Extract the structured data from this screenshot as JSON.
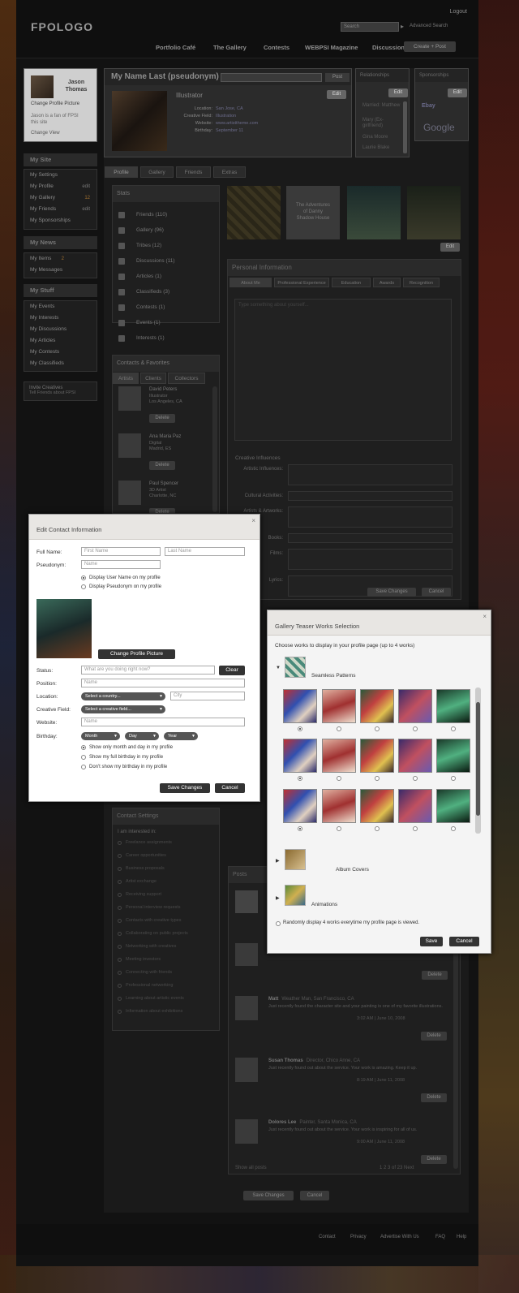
{
  "header": {
    "logo": "FPOLOGO",
    "logout": "Logout",
    "search_placeholder": "Search",
    "advanced_search": "Advanced Search",
    "nav": [
      "Portfolio Café",
      "The Gallery",
      "Contests",
      "WEBPSI Magazine",
      "Discussions"
    ],
    "create": "Create + Post"
  },
  "user": {
    "name_line1": "Jason",
    "name_line2": "Thomas",
    "change_pic": "Change Profile Picture",
    "status_line1": "Jason is a fan of FPSI",
    "status_line2": "this site",
    "change_view": "Change View"
  },
  "sidebar": {
    "my_site_head": "My Site",
    "my_site_items": [
      {
        "label": "My Settings",
        "cnt": ""
      },
      {
        "label": "My Profile",
        "cnt": "edit"
      },
      {
        "label": "My Gallery",
        "cnt": "12"
      },
      {
        "label": "My Friends",
        "cnt": "edit"
      },
      {
        "label": "My Sponsorships",
        "cnt": ""
      }
    ],
    "my_news_head": "My News",
    "my_news_items": [
      {
        "label": "My Items",
        "cnt": "2"
      },
      {
        "label": "My Messages",
        "cnt": ""
      }
    ],
    "my_stuff_head": "My Stuff",
    "my_stuff_items": [
      {
        "label": "My Events",
        "cnt": ""
      },
      {
        "label": "My Interests",
        "cnt": ""
      },
      {
        "label": "My Discussions",
        "cnt": ""
      },
      {
        "label": "My Articles",
        "cnt": ""
      },
      {
        "label": "My Contests",
        "cnt": ""
      },
      {
        "label": "My Classifieds",
        "cnt": ""
      }
    ],
    "invite_line1": "Invite Creatives",
    "invite_line2": "Tell Friends about FPSI"
  },
  "profile": {
    "header": "My Name Last (pseudonym)",
    "post": "Post",
    "title": "Illustrator",
    "edit": "Edit",
    "rows": [
      {
        "k": "Location:",
        "v": "San Jose, CA"
      },
      {
        "k": "Creative Field:",
        "v": "Illustration"
      },
      {
        "k": "Website:",
        "v": "www.artisttheme.com"
      },
      {
        "k": "Birthday:",
        "v": "September 11"
      }
    ]
  },
  "mini_boxes": {
    "relationships": "Relationships",
    "relationship_items": [
      "Married: Matthew",
      "Mary (Ex-girlfriend)",
      "Gina Moore",
      "Laurie Blake"
    ],
    "sponsorships": "Sponsorships",
    "sponsor_google": "Google",
    "sponsor_ebay": "Ebay"
  },
  "tabs": [
    "Profile",
    "Gallery",
    "Friends",
    "Extras"
  ],
  "stats": {
    "head": "Stats",
    "items": [
      "Friends (110)",
      "Gallery (96)",
      "Tribes (12)",
      "Discussions (11)",
      "Articles (1)",
      "Classifieds (3)",
      "Contests (1)",
      "Events (1)",
      "Interests (1)"
    ]
  },
  "gallery_teaser": {
    "doc_line1": "The Adventures",
    "doc_line2": "of Danny",
    "doc_line3": "Shadow House",
    "edit": "Edit"
  },
  "personal": {
    "head": "Personal Information",
    "tabs": [
      "About Me",
      "Professional Experience",
      "Education",
      "Awards",
      "Recognition"
    ],
    "textarea_placeholder": "Type something about yourself...",
    "creative_head": "Creative Influences",
    "fields": [
      {
        "k": "Artistic Influences:",
        "v": ""
      },
      {
        "k": "Cultural Activities:",
        "v": ""
      },
      {
        "k": "Artists & Artworks:",
        "v": ""
      },
      {
        "k": "Books:",
        "v": ""
      },
      {
        "k": "Films:",
        "v": ""
      },
      {
        "k": "Lyrics:",
        "v": ""
      }
    ],
    "save": "Save Changes",
    "cancel": "Cancel"
  },
  "contacts": {
    "head": "Contacts & Favorites",
    "tabs": [
      "Artists",
      "Clients",
      "Collectors"
    ],
    "items": [
      {
        "name": "David Peters",
        "role": "Illustrator",
        "loc": "Los Angeles, CA"
      },
      {
        "name": "Ana Maria Paz",
        "role": "Digital",
        "loc": "Madrid, ES"
      },
      {
        "name": "Paul Spencer",
        "role": "3D Artist",
        "loc": "Charlotte, NC"
      }
    ],
    "delete": "Delete"
  },
  "contact_settings": {
    "head": "Contact Settings",
    "intro": "I am interested in:",
    "items": [
      "Freelance assignments",
      "Career opportunities",
      "Business proposals",
      "Artist exchange",
      "Receiving support",
      "Personal interview requests",
      "Contacts with creative types",
      "Collaborating on public projects",
      "Networking with creatives",
      "Meeting investors",
      "Connecting with friends",
      "Professional networking",
      "Learning about artistic events",
      "Information about exhibitions"
    ]
  },
  "posts": {
    "head": "Posts",
    "items": [
      {
        "name": "Matt",
        "meta": "Weather Man, San Francisco, CA",
        "text": "Just recently found the character site and your painting is one of my favorite illustrations.",
        "time": "3:02 AM | June 10, 2008"
      },
      {
        "name": "Susan Thomas",
        "meta": "Director, Chico Anne, CA",
        "text": "Just recently found out about the service. Your work is amazing. Keep it up.",
        "time": "8:19 AM | June 11, 2008"
      },
      {
        "name": "Dolores Lee",
        "meta": "Painter, Santa Monica, CA",
        "text": "Just recently found out about the service. Your work is inspiring for all of us.",
        "time": "9:00 AM | June 11, 2008"
      }
    ],
    "delete": "Delete",
    "show_all": "Show all posts",
    "pager": "1 2 3 of 23 Next"
  },
  "bottom": {
    "save": "Save Changes",
    "cancel": "Cancel"
  },
  "footer": [
    "Contact",
    "Privacy",
    "Advertise With Us",
    "FAQ",
    "Help"
  ],
  "modal1": {
    "title": "Edit Contact Information",
    "close": "×",
    "full_name": "Full Name:",
    "first_ph": "First Name",
    "last_ph": "Last Name",
    "pseudonym": "Pseudonym:",
    "pseudo_ph": "Name",
    "radio_username": "Display User Name on my profile",
    "radio_pseudonym": "Display Pseudonym on my profile",
    "change_pic": "Change Profile Picture",
    "status": "Status:",
    "status_ph": "What are you doing right now?",
    "clear": "Clear",
    "position": "Position:",
    "position_ph": "Name",
    "location": "Location:",
    "country": "Select a country...",
    "city_ph": "City",
    "creative_field": "Creative Field:",
    "field_sel": "Select a creative field...",
    "website": "Website:",
    "website_ph": "Name",
    "birthday": "Birthday:",
    "month": "Month",
    "day": "Day",
    "year": "Year",
    "bd_opts": [
      "Show only month and day in my profile",
      "Show my full birthday in my profile",
      "Don't show my birthday in my profile"
    ],
    "save": "Save Changes",
    "cancel": "Cancel"
  },
  "modal2": {
    "title": "Gallery Teaser Works Selection",
    "close": "×",
    "intro": "Choose works to display in your profile page (up to 4 works)",
    "groups": [
      "Seamless Patterns",
      "Album Covers",
      "Animations"
    ],
    "random": "Randomly display 4 works everytime my profile page is viewed.",
    "save": "Save",
    "cancel": "Cancel"
  }
}
